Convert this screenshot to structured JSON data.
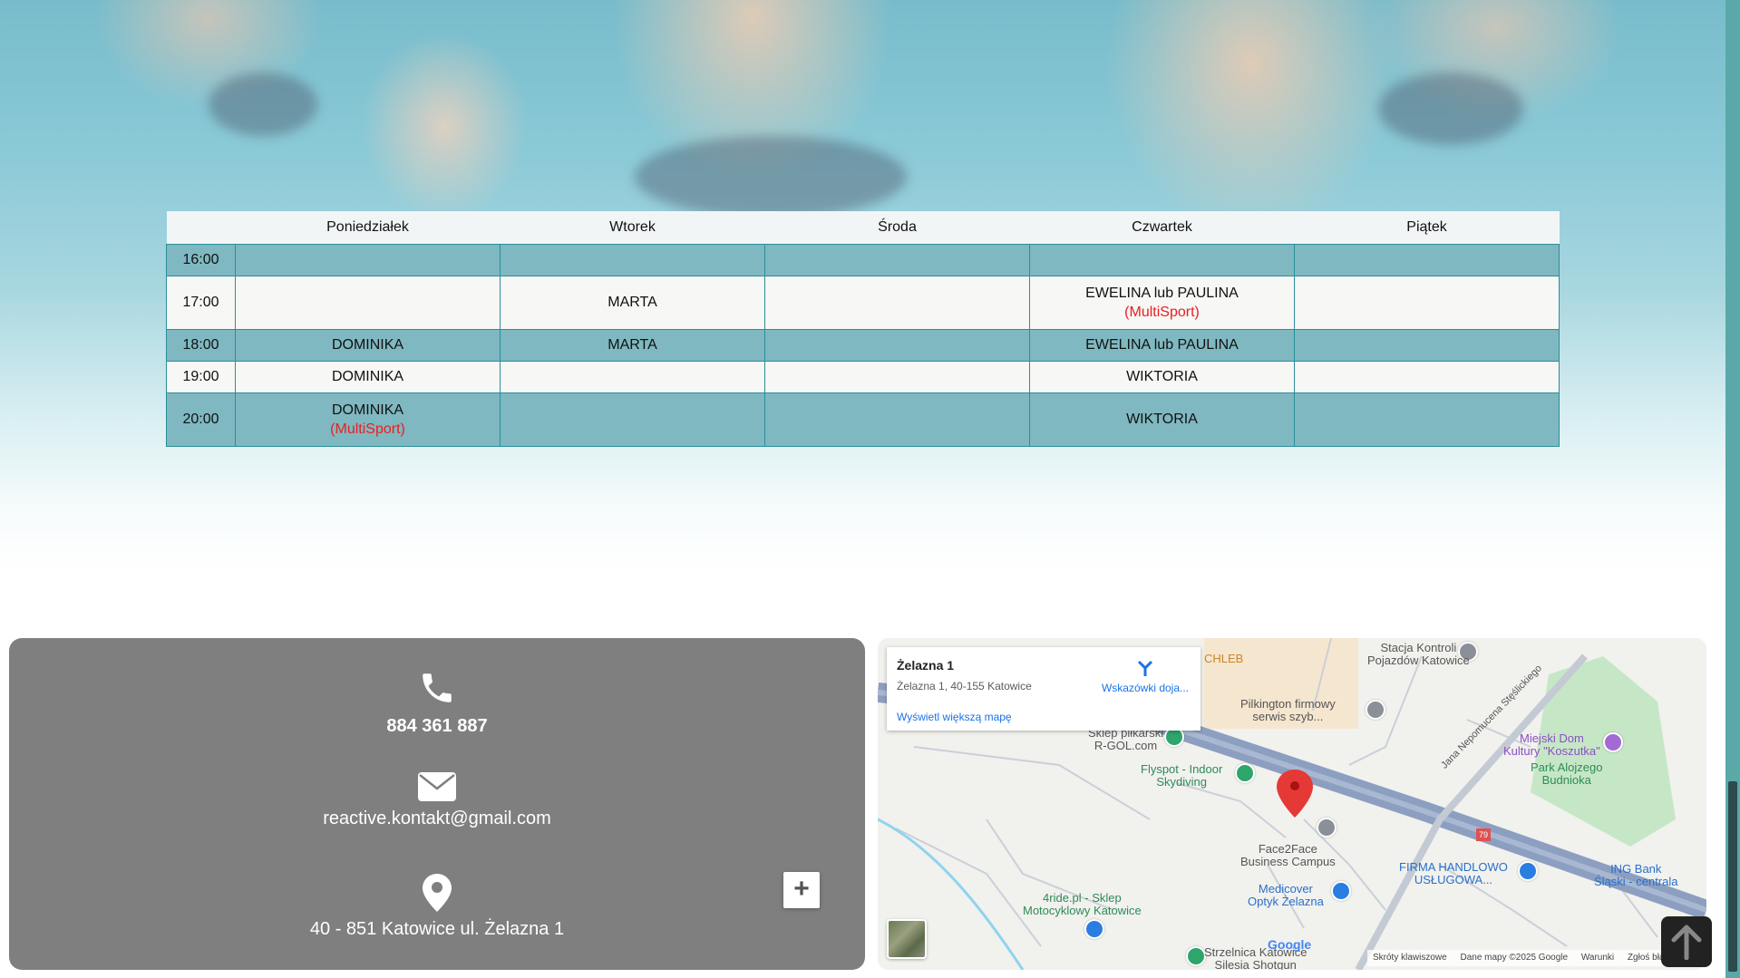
{
  "schedule": {
    "days": [
      "Poniedziałek",
      "Wtorek",
      "Środa",
      "Czwartek",
      "Piątek"
    ],
    "rows": [
      {
        "time": "16:00",
        "cells": [
          {
            "name": "",
            "note": ""
          },
          {
            "name": "",
            "note": ""
          },
          {
            "name": "",
            "note": ""
          },
          {
            "name": "",
            "note": ""
          },
          {
            "name": "",
            "note": ""
          }
        ]
      },
      {
        "time": "17:00",
        "cells": [
          {
            "name": "",
            "note": ""
          },
          {
            "name": "MARTA",
            "note": ""
          },
          {
            "name": "",
            "note": ""
          },
          {
            "name": "EWELINA lub PAULINA",
            "note": "(MultiSport)"
          },
          {
            "name": "",
            "note": ""
          }
        ]
      },
      {
        "time": "18:00",
        "cells": [
          {
            "name": "DOMINIKA",
            "note": ""
          },
          {
            "name": "MARTA",
            "note": ""
          },
          {
            "name": "",
            "note": ""
          },
          {
            "name": "EWELINA lub PAULINA",
            "note": ""
          },
          {
            "name": "",
            "note": ""
          }
        ]
      },
      {
        "time": "19:00",
        "cells": [
          {
            "name": "DOMINIKA",
            "note": ""
          },
          {
            "name": "",
            "note": ""
          },
          {
            "name": "",
            "note": ""
          },
          {
            "name": "WIKTORIA",
            "note": ""
          },
          {
            "name": "",
            "note": ""
          }
        ]
      },
      {
        "time": "20:00",
        "cells": [
          {
            "name": "DOMINIKA",
            "note": "(MultiSport)"
          },
          {
            "name": "",
            "note": ""
          },
          {
            "name": "",
            "note": ""
          },
          {
            "name": "WIKTORIA",
            "note": ""
          },
          {
            "name": "",
            "note": ""
          }
        ]
      }
    ],
    "colors": {
      "header_bg": "#f2f5f6",
      "teal_row": "#7fb8c1",
      "light_row": "#f7f7f5",
      "border": "#2a8f99",
      "multisport": "#e82020"
    }
  },
  "contact": {
    "phone": "884 361 887",
    "email": "reactive.kontakt@gmail.com",
    "address": "40 - 851 Katowice ul. Żelazna 1",
    "icons": [
      "phone-icon",
      "envelope-icon",
      "map-pin-icon"
    ],
    "panel_color": "#7f7f7f"
  },
  "map": {
    "card": {
      "title": "Żelazna 1",
      "address": "Żelazna 1, 40-155 Katowice",
      "directions": "Wskazówki doja...",
      "larger_map": "Wyświetl większą mapę"
    },
    "labels": {
      "chleb": "CHLEB",
      "stacja": "Stacja Kontroli\nPojazdów Katowice",
      "pilkington": "Pilkington firmowy\nserwis szyb...",
      "sklep": "Sklep piłkarski\nR-GOL.com",
      "flyspot": "Flyspot - Indoor\nSkydiving",
      "miejski": "Miejski Dom\nKultury \"Koszutka\"",
      "park": "Park Alojzego\nBudnioka",
      "street": "Jana Nepomucena Stęślickiego",
      "face2face": "Face2Face\nBusiness Campus",
      "firma": "FIRMA HANDLOWO\nUSŁUGOWA...",
      "ing": "ING Bank\nŚląski - centrala",
      "medicover": "Medicover\nOptyk Żelazna",
      "4ride": "4ride.pl - Sklep\nMotocyklowy Katowice",
      "strzelnica": "Strzelnica Katowice\nSilesia Shotgun",
      "road_no": "79"
    },
    "logo": "Google",
    "footer": [
      "Skróty klawiszowe",
      "Dane mapy ©2025 Google",
      "Warunki",
      "Zgłoś błąd w mapach"
    ],
    "zoom_in": "+"
  },
  "scroll_top_icon": "arrow-up-icon"
}
